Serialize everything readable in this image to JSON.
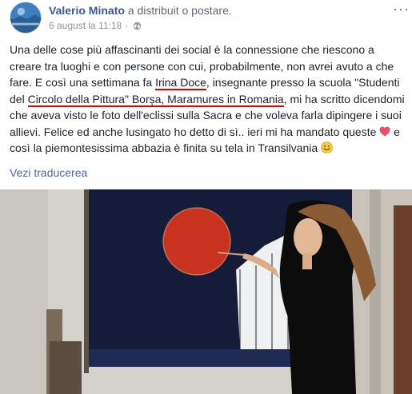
{
  "post": {
    "author": "Valerio Minato",
    "action": "a distribuit o postare.",
    "date": "6 august la 11:18",
    "separator": "·",
    "more_glyph": "···",
    "text": {
      "p1": "Una delle cose più affascinanti dei social è la connessione che riescono a creare tra luoghi e con persone con cui, probabilmente, non avrei avuto a che fare. E così una settimana fa ",
      "name": "Irina Doce",
      "p2": ", insegnante presso la scuola \"Studenti del ",
      "school": "Circolo della Pittura\" Borșa, Maramures in Romania",
      "p3": ", mi ha scritto dicendomi che aveva visto le foto dell'eclissi sulla Sacra e che voleva farla dipingere i suoi allievi. Felice ed anche lusingato ho detto di sì.. ieri mi ha mandato queste ",
      "p4": " e così la piemontesissima abbazia è finita su tela in Transilvania "
    },
    "translate": "Vezi traducerea"
  },
  "colors": {
    "author": "#385898",
    "link": "#4b67a1",
    "underline": "#e00000",
    "moon": "#c8321e",
    "canvas": "#141c3a"
  },
  "icons": [
    "globe-icon",
    "more-icon",
    "heart-icon",
    "smile-icon"
  ]
}
